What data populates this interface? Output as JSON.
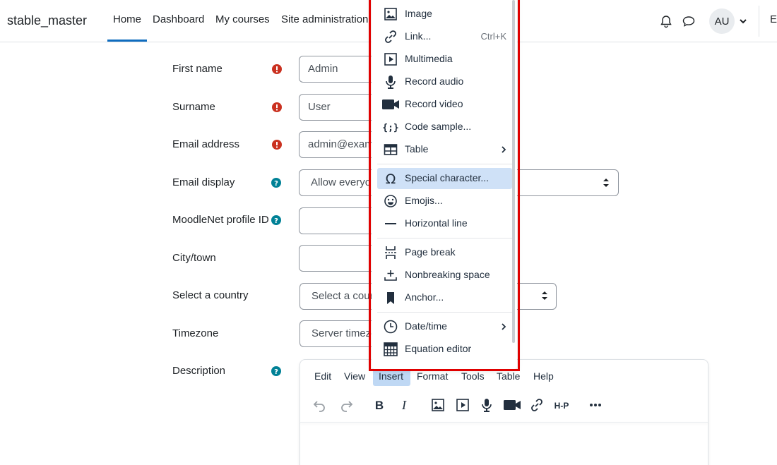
{
  "navbar": {
    "brand": "stable_master",
    "items": [
      "Home",
      "Dashboard",
      "My courses",
      "Site administration"
    ],
    "avatar": "AU",
    "edit_fragment": "E"
  },
  "form": {
    "first_name": {
      "label": "First name",
      "value": "Admin"
    },
    "surname": {
      "label": "Surname",
      "value": "User"
    },
    "email": {
      "label": "Email address",
      "value": "admin@exam"
    },
    "email_display": {
      "label": "Email display",
      "value": "Allow everyon"
    },
    "moodlenet": {
      "label": "MoodleNet profile ID",
      "value": ""
    },
    "city": {
      "label": "City/town",
      "value": ""
    },
    "country": {
      "label": "Select a country",
      "value": "Select a cour"
    },
    "timezone": {
      "label": "Timezone",
      "value": "Server timezo"
    },
    "description": {
      "label": "Description"
    }
  },
  "editor": {
    "menubar": [
      "Edit",
      "View",
      "Insert",
      "Format",
      "Tools",
      "Table",
      "Help"
    ],
    "active_menu": "Insert",
    "toolbar_icons": [
      "undo-icon",
      "redo-icon",
      "bold-icon",
      "italic-icon",
      "image-icon",
      "media-icon",
      "microphone-icon",
      "video-camera-icon",
      "link-icon",
      "h5p-icon",
      "more-icon"
    ]
  },
  "insert_menu": {
    "items": [
      {
        "label": "Image",
        "icon": "image-icon"
      },
      {
        "label": "Link...",
        "icon": "link-icon",
        "shortcut": "Ctrl+K"
      },
      {
        "label": "Multimedia",
        "icon": "media-icon"
      },
      {
        "label": "Record audio",
        "icon": "microphone-icon"
      },
      {
        "label": "Record video",
        "icon": "video-camera-icon"
      },
      {
        "label": "Code sample...",
        "icon": "code-sample-icon"
      },
      {
        "label": "Table",
        "icon": "table-icon",
        "submenu": true
      },
      {
        "label": "Special character...",
        "icon": "omega-icon",
        "active": true
      },
      {
        "label": "Emojis...",
        "icon": "emoji-icon"
      },
      {
        "label": "Horizontal line",
        "icon": "horizontal-line-icon"
      },
      {
        "label": "Page break",
        "icon": "page-break-icon"
      },
      {
        "label": "Nonbreaking space",
        "icon": "nbsp-icon"
      },
      {
        "label": "Anchor...",
        "icon": "bookmark-icon"
      },
      {
        "label": "Date/time",
        "icon": "clock-icon",
        "submenu": true
      },
      {
        "label": "Equation editor",
        "icon": "calculator-icon"
      }
    ]
  },
  "colors": {
    "accent": "#0f6cbf",
    "required": "#ca3120",
    "help": "#008196",
    "menu_active": "#cfe1f7",
    "highlight_outline": "#e00000"
  }
}
